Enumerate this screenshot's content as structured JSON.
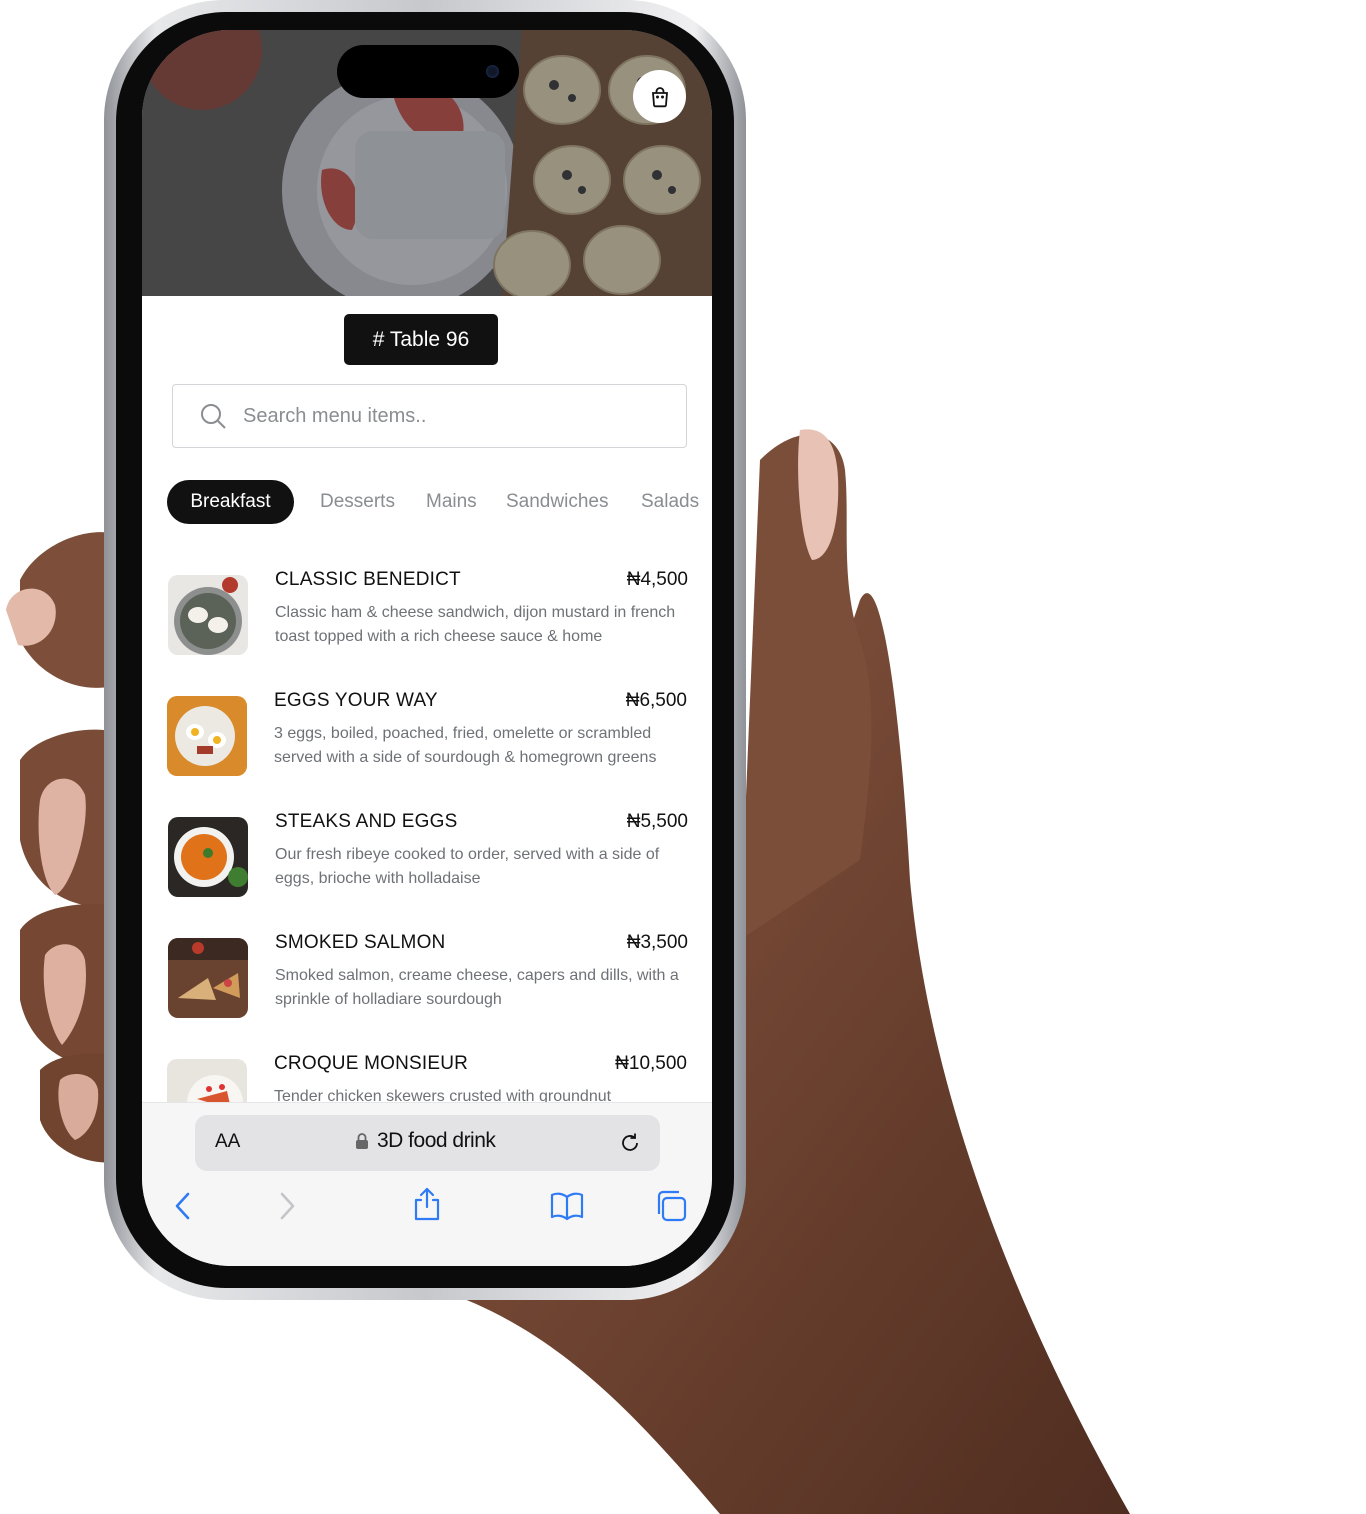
{
  "table": {
    "label": "# Table 96"
  },
  "search": {
    "placeholder": "Search menu items.."
  },
  "tabs": [
    {
      "label": "Breakfast",
      "active": true
    },
    {
      "label": "Desserts",
      "active": false
    },
    {
      "label": "Mains",
      "active": false
    },
    {
      "label": "Sandwiches",
      "active": false
    },
    {
      "label": "Salads",
      "active": false
    }
  ],
  "menu": [
    {
      "name": "CLASSIC BENEDICT",
      "price": "₦4,500",
      "desc": "Classic ham & cheese sandwich, dijon mustard in french toast topped with a rich cheese sauce & home"
    },
    {
      "name": "EGGS YOUR WAY",
      "price": "₦6,500",
      "desc": "3 eggs, boiled, poached, fried, omelette or scrambled served with a side of sourdough & homegrown greens"
    },
    {
      "name": "STEAKS AND EGGS",
      "price": "₦5,500",
      "desc": "Our fresh ribeye cooked to order, served with a side of eggs, brioche with holladaise"
    },
    {
      "name": "SMOKED SALMON",
      "price": "₦3,500",
      "desc": "Smoked salmon, creame cheese, capers and dills, with a sprinkle of holladiare sourdough"
    },
    {
      "name": "CROQUE MONSIEUR",
      "price": "₦10,500",
      "desc": "Tender chicken skewers crusted with groundnut"
    }
  ],
  "browser": {
    "text_size": "AA",
    "url": "3D food drink"
  },
  "icons": [
    "shopping-bag-icon",
    "search-icon",
    "lock-icon",
    "reload-icon",
    "back-icon",
    "forward-icon",
    "share-icon",
    "bookmarks-icon",
    "tabs-icon"
  ],
  "colors": {
    "accent": "#111111",
    "link_blue": "#2f7bf5",
    "muted_text": "#6e7176"
  }
}
